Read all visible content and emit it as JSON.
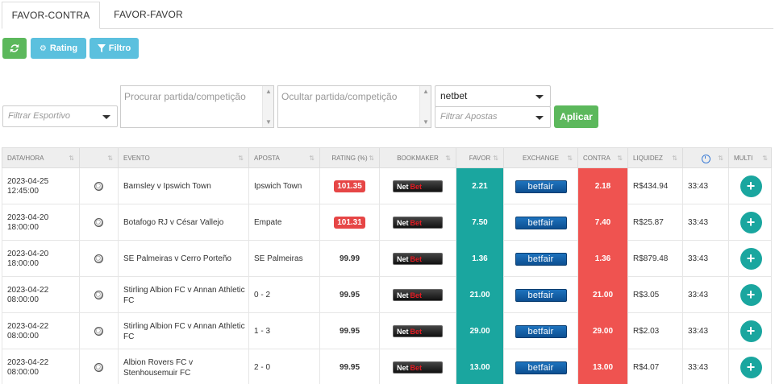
{
  "tabs": [
    {
      "label": "FAVOR-CONTRA",
      "active": true
    },
    {
      "label": "FAVOR-FAVOR",
      "active": false
    }
  ],
  "toolbar": {
    "refresh_icon": "refresh-icon",
    "rating_label": "Rating",
    "filtro_label": "Filtro"
  },
  "filters": {
    "sport_placeholder": "Filtrar Esportivo",
    "search_placeholder": "Procurar partida/competição",
    "hide_placeholder": "Ocultar partida/competição",
    "bookmaker_value": "netbet",
    "bets_placeholder": "Filtrar Apostas",
    "apply_label": "Aplicar"
  },
  "table": {
    "headers": [
      "DATA/HORA",
      "",
      "EVENTO",
      "APOSTA",
      "RATING (%)",
      "BOOKMAKER",
      "FAVOR",
      "EXCHANGE",
      "CONTRA",
      "LIQUIDEZ",
      "",
      "MULTI"
    ],
    "rows": [
      {
        "date": "2023-04-25",
        "time": "12:45:00",
        "event": "Barnsley v Ipswich Town",
        "bet": "Ipswich Town",
        "rating": "101.35",
        "rating_highlight": true,
        "favor": "2.21",
        "contra": "2.18",
        "liquidez": "R$434.94",
        "timer": "33:43"
      },
      {
        "date": "2023-04-20",
        "time": "18:00:00",
        "event": "Botafogo RJ v César Vallejo",
        "bet": "Empate",
        "rating": "101.31",
        "rating_highlight": true,
        "favor": "7.50",
        "contra": "7.40",
        "liquidez": "R$25.87",
        "timer": "33:43"
      },
      {
        "date": "2023-04-20",
        "time": "18:00:00",
        "event": "SE Palmeiras v Cerro Porteño",
        "bet": "SE Palmeiras",
        "rating": "99.99",
        "rating_highlight": false,
        "favor": "1.36",
        "contra": "1.36",
        "liquidez": "R$879.48",
        "timer": "33:43"
      },
      {
        "date": "2023-04-22",
        "time": "08:00:00",
        "event": "Stirling Albion FC v Annan Athletic FC",
        "bet": "0 - 2",
        "rating": "99.95",
        "rating_highlight": false,
        "favor": "21.00",
        "contra": "21.00",
        "liquidez": "R$3.05",
        "timer": "33:43"
      },
      {
        "date": "2023-04-22",
        "time": "08:00:00",
        "event": "Stirling Albion FC v Annan Athletic FC",
        "bet": "1 - 3",
        "rating": "99.95",
        "rating_highlight": false,
        "favor": "29.00",
        "contra": "29.00",
        "liquidez": "R$2.03",
        "timer": "33:43"
      },
      {
        "date": "2023-04-22",
        "time": "08:00:00",
        "event": "Albion Rovers FC v Stenhousemuir FC",
        "bet": "2 - 0",
        "rating": "99.95",
        "rating_highlight": false,
        "favor": "13.00",
        "contra": "13.00",
        "liquidez": "R$4.07",
        "timer": "33:43"
      }
    ],
    "bookmaker_logo_text": [
      "Net",
      "Bet"
    ],
    "exchange_logo_text": "betfair"
  },
  "colors": {
    "favor": "#1aa69f",
    "contra": "#ef5350",
    "green_button": "#5cb85c",
    "blue_button": "#5bc0de"
  }
}
